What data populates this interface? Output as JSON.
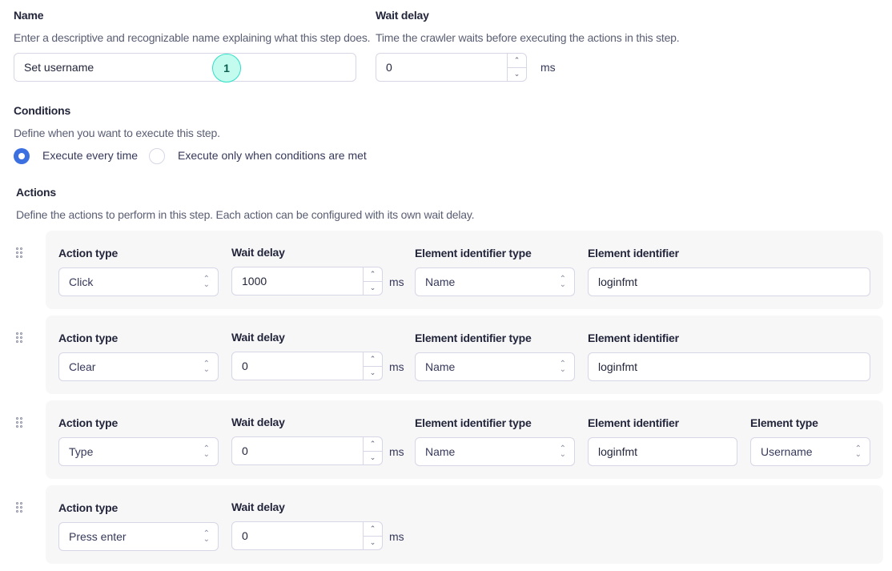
{
  "name_section": {
    "label": "Name",
    "description": "Enter a descriptive and recognizable name explaining what this step does.",
    "value": "Set username",
    "badge": "1"
  },
  "wait_section": {
    "label": "Wait delay",
    "description": "Time the crawler waits before executing the actions in this step.",
    "value": "0",
    "unit": "ms"
  },
  "conditions": {
    "label": "Conditions",
    "description": "Define when you want to execute this step.",
    "options": [
      {
        "label": "Execute every time",
        "selected": true
      },
      {
        "label": "Execute only when conditions are met",
        "selected": false
      }
    ]
  },
  "actions": {
    "label": "Actions",
    "description": "Define the actions to perform in this step. Each action can be configured with its own wait delay.",
    "field_labels": {
      "action_type": "Action type",
      "wait_delay": "Wait delay",
      "element_identifier_type": "Element identifier type",
      "element_identifier": "Element identifier",
      "element_type": "Element type",
      "unit": "ms"
    },
    "items": [
      {
        "action_type": "Click",
        "wait_delay": "1000",
        "element_identifier_type": "Name",
        "element_identifier": "loginfmt"
      },
      {
        "action_type": "Clear",
        "wait_delay": "0",
        "element_identifier_type": "Name",
        "element_identifier": "loginfmt"
      },
      {
        "action_type": "Type",
        "wait_delay": "0",
        "element_identifier_type": "Name",
        "element_identifier": "loginfmt",
        "element_type": "Username"
      },
      {
        "action_type": "Press enter",
        "wait_delay": "0"
      }
    ]
  },
  "icons": {
    "spinner_up": "chevron-up-icon",
    "spinner_down": "chevron-down-icon",
    "select_caret": "chevron-up-down-icon",
    "drag_handle": "drag-handle-icon"
  },
  "colors": {
    "accent": "#3c6fe0",
    "badge_bg": "#c3fbef",
    "badge_border": "#2ee0c6",
    "card_bg": "#f7f7f8"
  }
}
